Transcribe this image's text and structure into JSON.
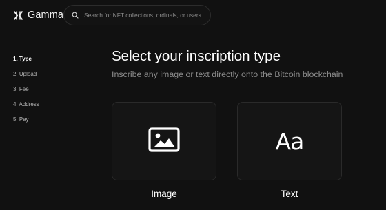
{
  "header": {
    "logo_text": "Gamma",
    "search_placeholder": "Search for NFT collections, ordinals, or users"
  },
  "steps": [
    {
      "label": "1. Type",
      "active": true
    },
    {
      "label": "2. Upload",
      "active": false
    },
    {
      "label": "3. Fee",
      "active": false
    },
    {
      "label": "4. Address",
      "active": false
    },
    {
      "label": "5. Pay",
      "active": false
    }
  ],
  "main": {
    "title": "Select your inscription type",
    "subtitle": "Inscribe any image or text directly onto the Bitcoin blockchain",
    "options": [
      {
        "label": "Image",
        "icon": "image-icon"
      },
      {
        "label": "Text",
        "icon": "text-icon",
        "glyph": "Aa"
      }
    ]
  },
  "colors": {
    "background": "#111111",
    "card_background": "#151515",
    "card_border": "#2a2a2a",
    "text_primary": "#ffffff",
    "text_muted": "#8c8c8c"
  }
}
